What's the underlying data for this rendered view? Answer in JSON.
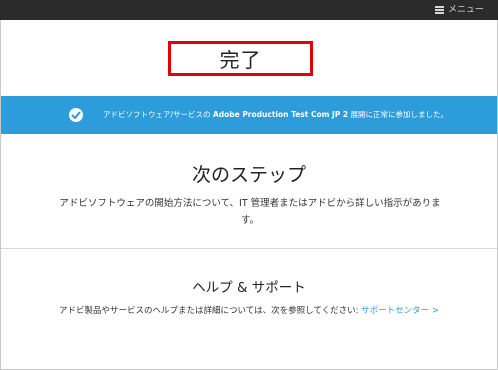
{
  "topbar": {
    "menu_label": "メニュー",
    "menu_icon": "hamburger-icon"
  },
  "status": {
    "title": "完了"
  },
  "banner": {
    "icon": "check-circle-icon",
    "prefix": "アドビソフトウェア/サービスの ",
    "org_name": "Adobe Production Test Com JP 2",
    "suffix": " 展開に正常に参加しました。",
    "bg_color": "#2d9cdb"
  },
  "next_steps": {
    "title": "次のステップ",
    "description_line1": "アドビソフトウェアの開始方法について、IT 管理者またはアドビから詳しい指示がありま",
    "description_line2": "す。"
  },
  "help": {
    "title": "ヘルプ & サポート",
    "text": "アドビ製品やサービスのヘルプまたは詳細については、次を参照してください: ",
    "link_label": "サポートセンター >",
    "link_color": "#2d9cdb"
  }
}
